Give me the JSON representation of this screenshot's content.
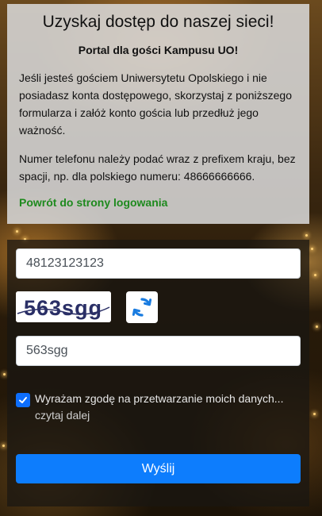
{
  "header": {
    "title": "Uzyskaj dostęp do naszej sieci!",
    "subtitle": "Portal dla gości Kampusu UO!",
    "paragraph1": "Jeśli jesteś gościem Uniwersytetu Opolskiego i nie posiadasz konta dostępowego, skorzystaj z poniższego formularza i załóż konto gościa lub przedłuż jego ważność.",
    "paragraph2": "Numer telefonu należy podać wraz z prefixem kraju, bez spacji, np. dla polskiego numeru: 48666666666.",
    "back_link": "Powrót do strony logowania"
  },
  "form": {
    "phone_value": "48123123123",
    "captcha_text": "563sgg",
    "captcha_input_value": "563sgg",
    "consent_label": "Wyrażam zgodę na przetwarzanie moich danych...",
    "consent_more": "czytaj dalej",
    "consent_checked": true,
    "submit_label": "Wyślij"
  },
  "icons": {
    "refresh": "refresh-icon",
    "check": "check-icon"
  },
  "colors": {
    "accent": "#0d7dfd",
    "link_green": "#1e8a1e"
  }
}
